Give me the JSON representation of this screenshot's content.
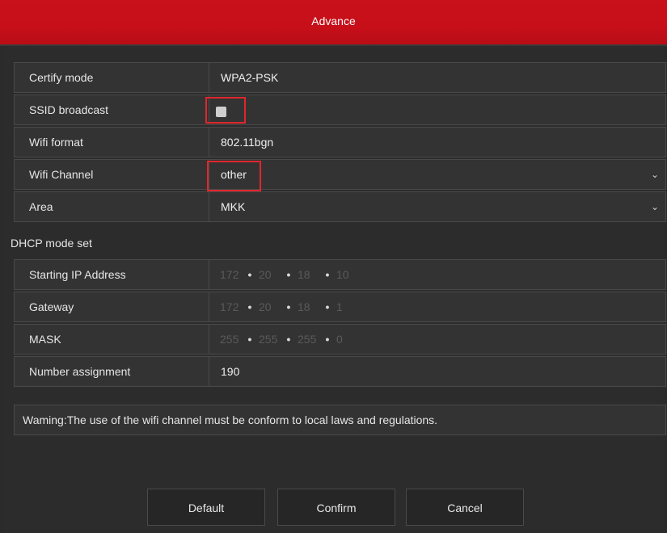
{
  "window": {
    "title": "Advance"
  },
  "wifi": {
    "certify_mode": {
      "label": "Certify mode",
      "value": "WPA2-PSK"
    },
    "ssid_broadcast": {
      "label": "SSID broadcast",
      "checked": true
    },
    "wifi_format": {
      "label": "Wifi format",
      "value": "802.11bgn"
    },
    "wifi_channel": {
      "label": "Wifi Channel",
      "value": "other"
    },
    "area": {
      "label": "Area",
      "value": "MKK"
    }
  },
  "dhcp": {
    "section_title": "DHCP mode set",
    "starting_ip": {
      "label": "Starting IP Address",
      "octets": [
        "172",
        "20",
        "18",
        "10"
      ]
    },
    "gateway": {
      "label": "Gateway",
      "octets": [
        "172",
        "20",
        "18",
        "1"
      ]
    },
    "mask": {
      "label": "MASK",
      "octets": [
        "255",
        "255",
        "255",
        "0"
      ]
    },
    "number_assignment": {
      "label": "Number assignment",
      "value": "190"
    }
  },
  "warning": "Waming:The use of the wifi channel must be conform to local laws and regulations.",
  "buttons": {
    "default": "Default",
    "confirm": "Confirm",
    "cancel": "Cancel"
  },
  "colors": {
    "title_bar": "#c9111b",
    "highlight": "#e0262d",
    "background": "#2b2b2b"
  },
  "icons": {
    "dropdown": "chevron-down-icon",
    "dot": "ip-separator-dot"
  }
}
